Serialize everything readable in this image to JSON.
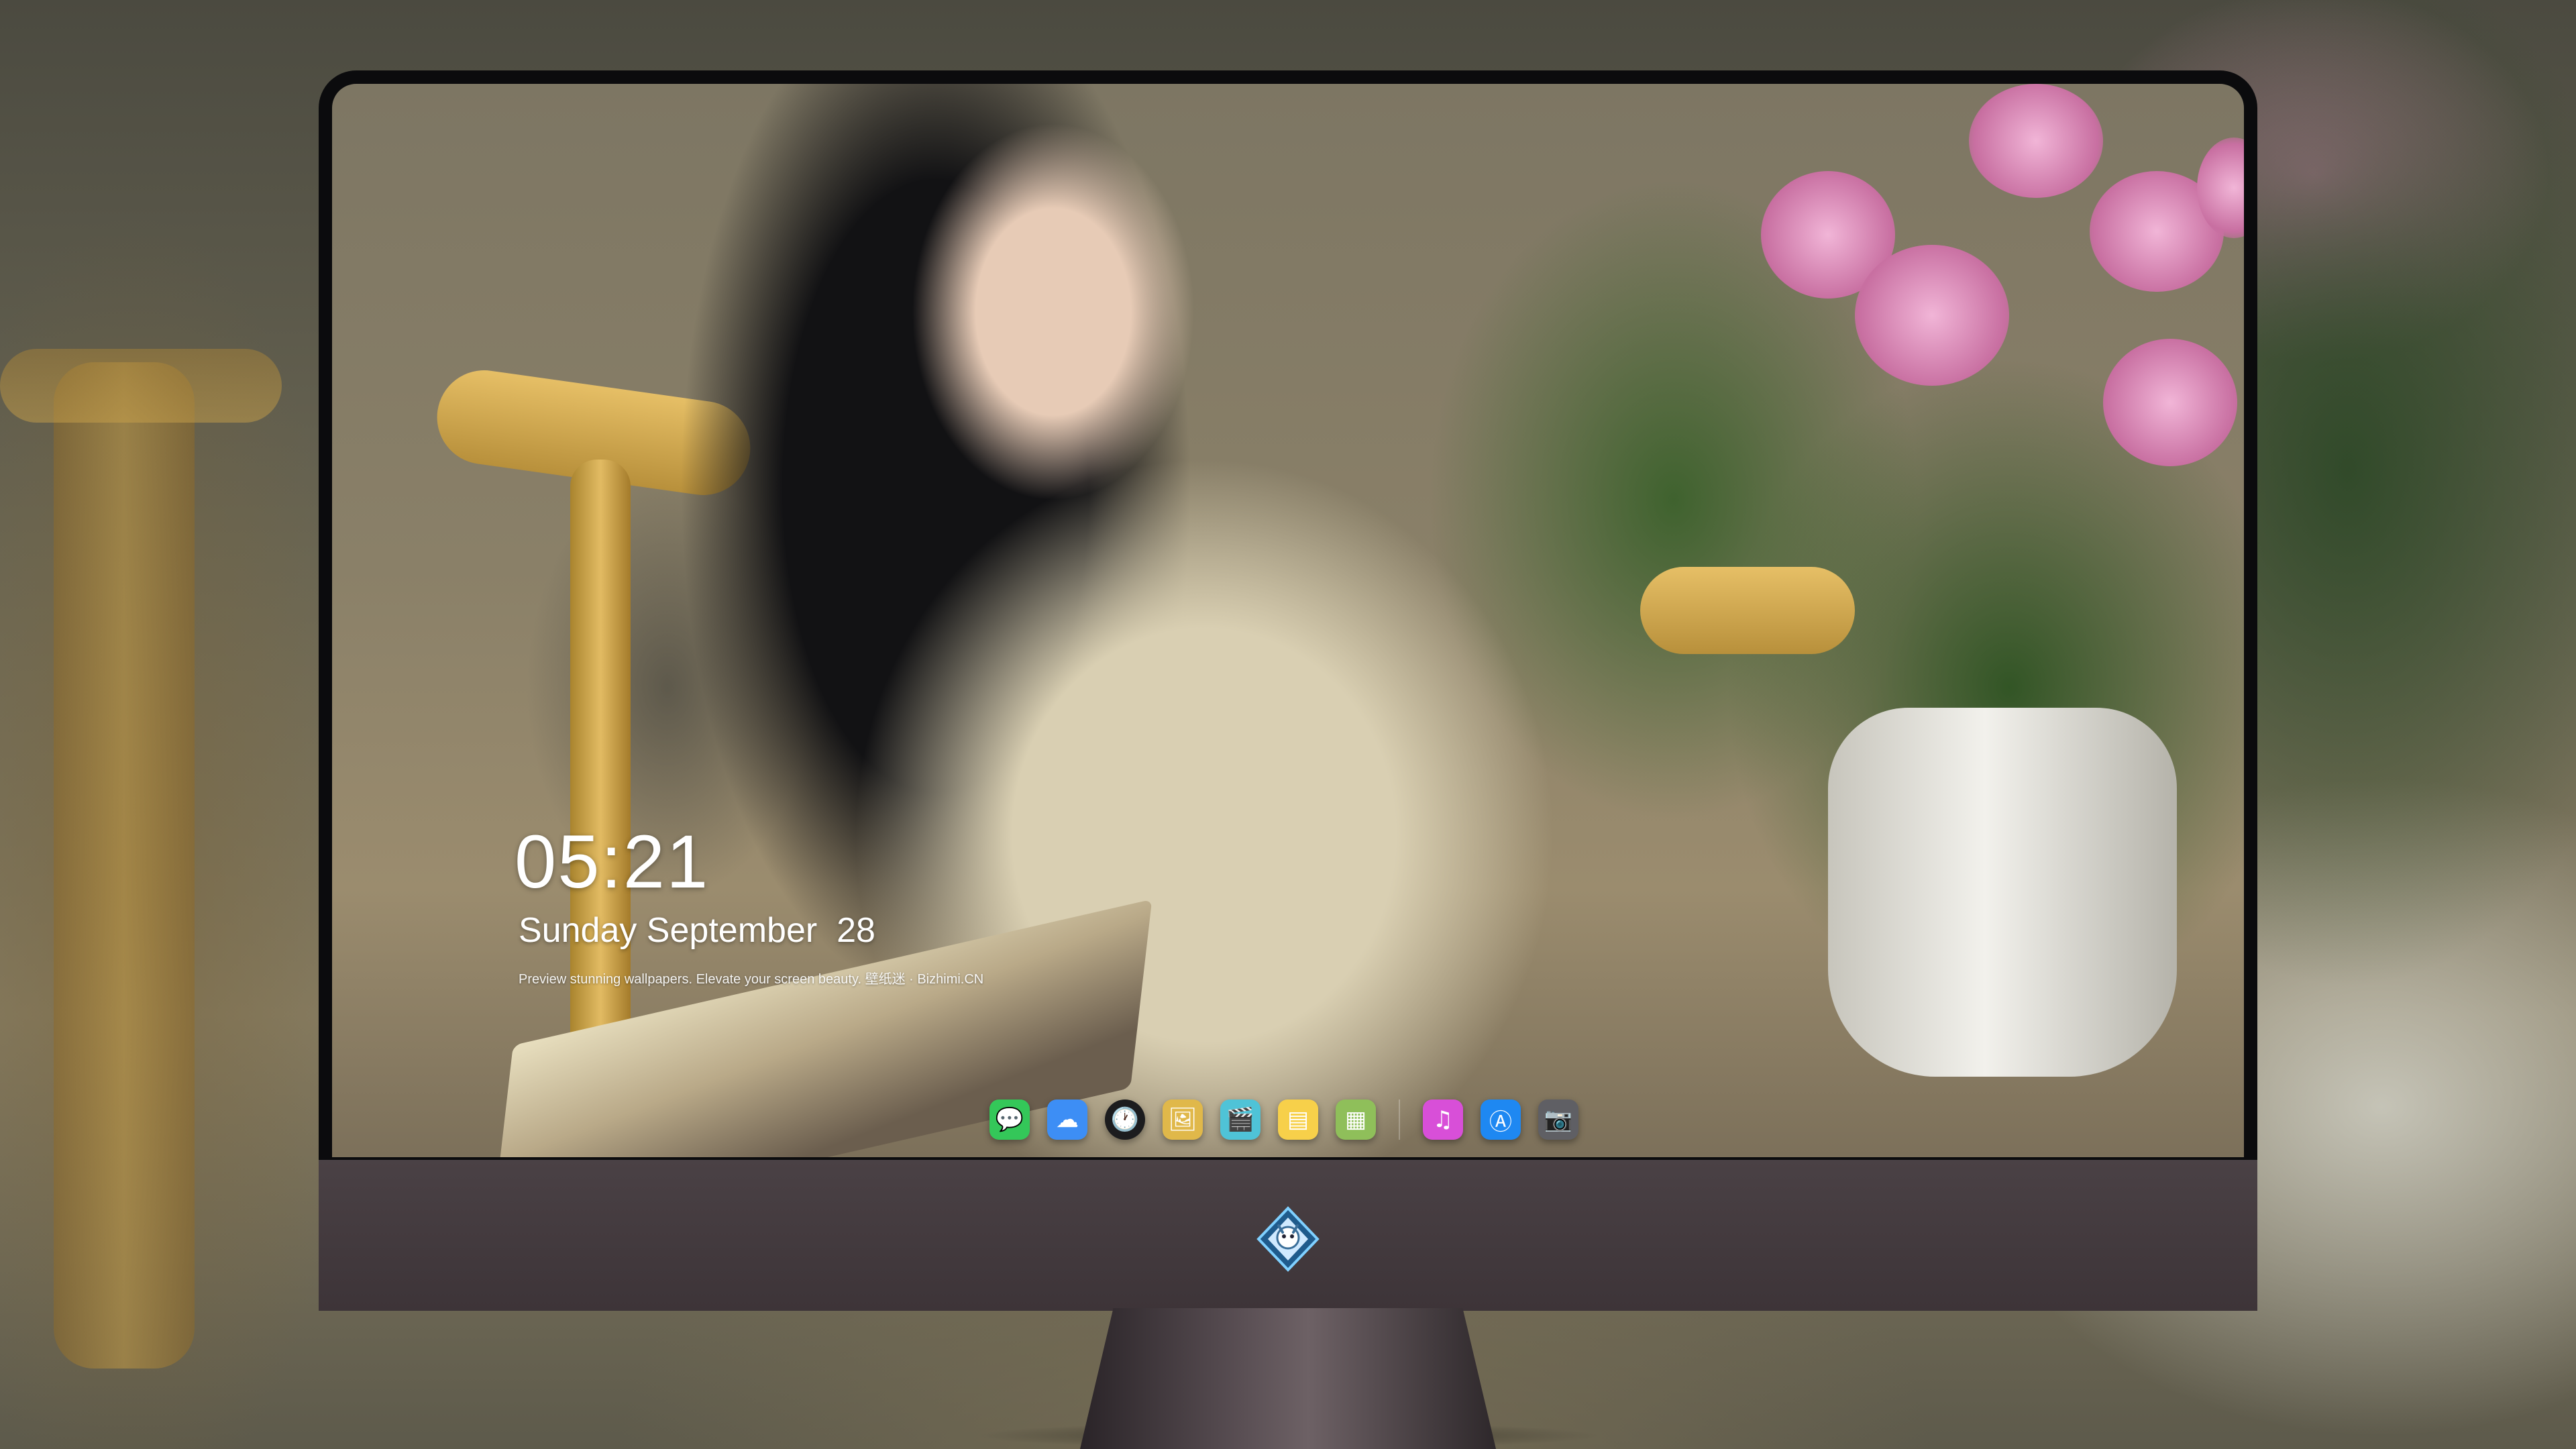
{
  "lockscreen": {
    "time": "05:21",
    "date": "Sunday September  28",
    "tagline": "Preview stunning wallpapers. Elevate your screen beauty. 壁纸迷 · Bizhimi.CN"
  },
  "dock": {
    "apps": [
      {
        "name": "Messages",
        "icon": "messages-icon",
        "color": "#34c759",
        "glyph": "💬"
      },
      {
        "name": "Weather",
        "icon": "weather-icon",
        "color": "#3d8ef5",
        "glyph": "☁"
      },
      {
        "name": "Clock",
        "icon": "clock-icon",
        "color": "#1c1c1e",
        "glyph": "🕐"
      },
      {
        "name": "Preview",
        "icon": "preview-icon",
        "color": "#e0b84a",
        "glyph": "🖼"
      },
      {
        "name": "Final Cut",
        "icon": "clapper-icon",
        "color": "#4fc3d7",
        "glyph": "🎬"
      },
      {
        "name": "Notes",
        "icon": "notes-icon",
        "color": "#f7d04a",
        "glyph": "▤"
      },
      {
        "name": "Photo Booth",
        "icon": "photobooth-icon",
        "color": "#8fbf5a",
        "glyph": "▦"
      },
      {
        "name": "iTunes",
        "icon": "music-icon",
        "color": "#d84fd8",
        "glyph": "♫"
      },
      {
        "name": "App Store",
        "icon": "appstore-icon",
        "color": "#1e88f2",
        "glyph": "Ⓐ"
      },
      {
        "name": "Camera",
        "icon": "camera-icon",
        "color": "#5f5f64",
        "glyph": "📷"
      }
    ]
  },
  "colors": {
    "monitor_bezel": "#0b0b0d",
    "monitor_chin": "#4a4145",
    "clock_text": "#ffffff"
  }
}
